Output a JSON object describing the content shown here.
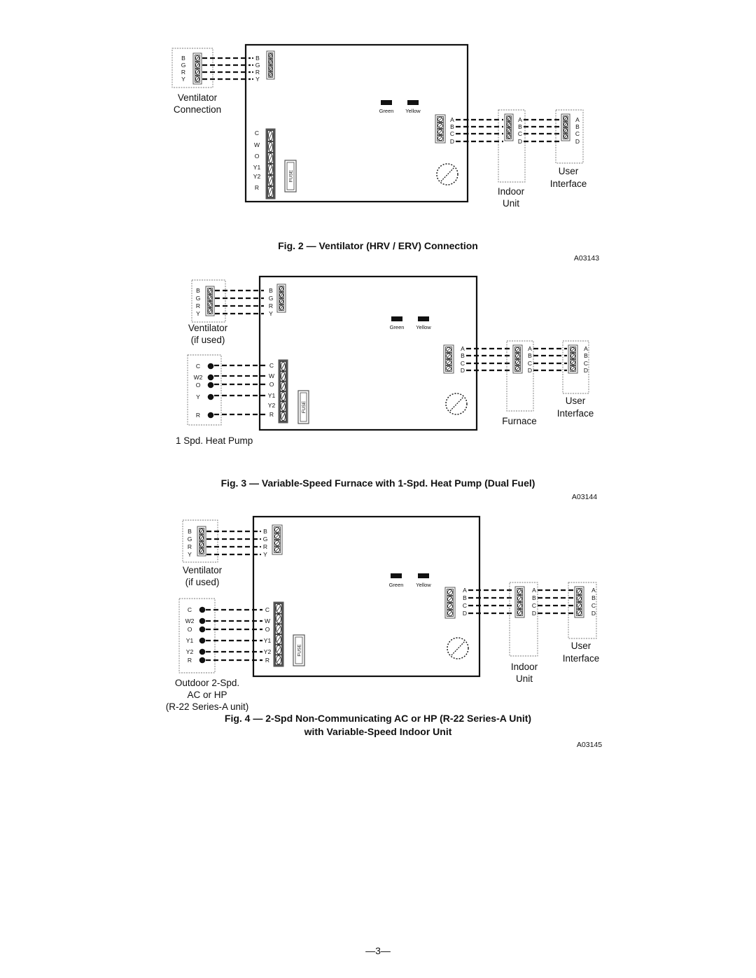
{
  "figures": [
    {
      "id": "fig2",
      "caption": "Fig. 2 — Ventilator (HRV / ERV) Connection",
      "caption_line2": "",
      "code": "A03143",
      "ventilator_label": [
        "Ventilator",
        "Connection"
      ],
      "ventilator_terminals": [
        "B",
        "G",
        "R",
        "Y"
      ],
      "board_vent_terminals": [
        "B",
        "G",
        "R",
        "Y"
      ],
      "board_thermostat_terminals": [
        "C",
        "W",
        "O",
        "Y1",
        "Y2",
        "R"
      ],
      "fuse_label": "FUSE",
      "led_labels": [
        "Green",
        "Yellow"
      ],
      "abcd_terminals": [
        "A",
        "B",
        "C",
        "D"
      ],
      "middle_unit_label": [
        "Indoor",
        "Unit"
      ],
      "user_interface_label": [
        "User",
        "Interface"
      ],
      "outdoor_label": [],
      "outdoor_terminals": []
    },
    {
      "id": "fig3",
      "caption": "Fig. 3 — Variable-Speed Furnace with 1-Spd. Heat Pump (Dual Fuel)",
      "caption_line2": "",
      "code": "A03144",
      "ventilator_label": [
        "Ventilator",
        "(if used)"
      ],
      "ventilator_terminals": [
        "B",
        "G",
        "R",
        "Y"
      ],
      "board_vent_terminals": [
        "B",
        "G",
        "R",
        "Y"
      ],
      "board_thermostat_terminals": [
        "C",
        "W",
        "O",
        "Y1",
        "Y2",
        "R"
      ],
      "fuse_label": "FUSE",
      "led_labels": [
        "Green",
        "Yellow"
      ],
      "abcd_terminals": [
        "A",
        "B",
        "C",
        "D"
      ],
      "middle_unit_label": [
        "Furnace"
      ],
      "user_interface_label": [
        "User",
        "Interface"
      ],
      "outdoor_label": [
        "1 Spd. Heat Pump"
      ],
      "outdoor_terminals": [
        "C",
        "W2",
        "O",
        "Y",
        "R"
      ]
    },
    {
      "id": "fig4",
      "caption": "Fig. 4 — 2-Spd Non-Communicating AC or HP (R-22 Series-A Unit)",
      "caption_line2": "with Variable-Speed Indoor Unit",
      "code": "A03145",
      "ventilator_label": [
        "Ventilator",
        "(if used)"
      ],
      "ventilator_terminals": [
        "B",
        "G",
        "R",
        "Y"
      ],
      "board_vent_terminals": [
        "B",
        "G",
        "R",
        "Y"
      ],
      "board_thermostat_terminals": [
        "C",
        "W",
        "O",
        "Y1",
        "Y2",
        "R"
      ],
      "fuse_label": "FUSE",
      "led_labels": [
        "Green",
        "Yellow"
      ],
      "abcd_terminals": [
        "A",
        "B",
        "C",
        "D"
      ],
      "middle_unit_label": [
        "Indoor",
        "Unit"
      ],
      "user_interface_label": [
        "User",
        "Interface"
      ],
      "outdoor_label": [
        "Outdoor 2-Spd.",
        "AC or HP",
        "(R-22 Series-A unit)"
      ],
      "outdoor_terminals": [
        "C",
        "W2",
        "O",
        "Y1",
        "Y2",
        "R"
      ]
    }
  ],
  "page_number": "—3—"
}
